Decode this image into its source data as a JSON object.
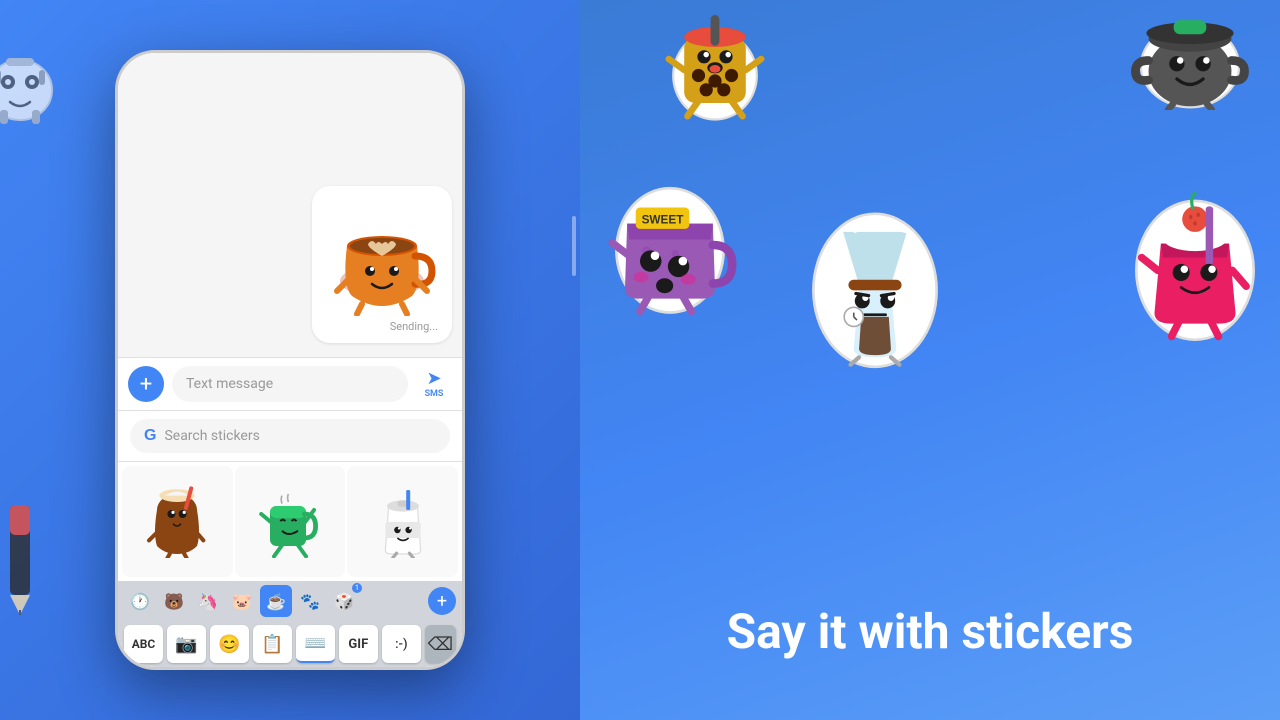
{
  "left_panel": {
    "chat": {
      "sending_label": "Sending...",
      "text_input_placeholder": "Text message",
      "send_label": "SMS"
    },
    "sticker_search": {
      "placeholder": "Search stickers",
      "google_logo": "G"
    },
    "keyboard": {
      "tabs": [
        "🕐",
        "🐻",
        "🦄",
        "🐷",
        "☕",
        "🐾",
        "🎲"
      ],
      "bottom_keys": [
        "ABC",
        "📷",
        "😊",
        "📋",
        "⌨️",
        "GIF",
        ":-)"
      ],
      "plus_label": "+"
    }
  },
  "right_panel": {
    "tagline": "Say it with stickers",
    "stickers": [
      "coffee-cup-sticker",
      "pot-sticker",
      "purple-mug-sticker",
      "chemex-sticker",
      "strawberry-shake-sticker"
    ]
  }
}
